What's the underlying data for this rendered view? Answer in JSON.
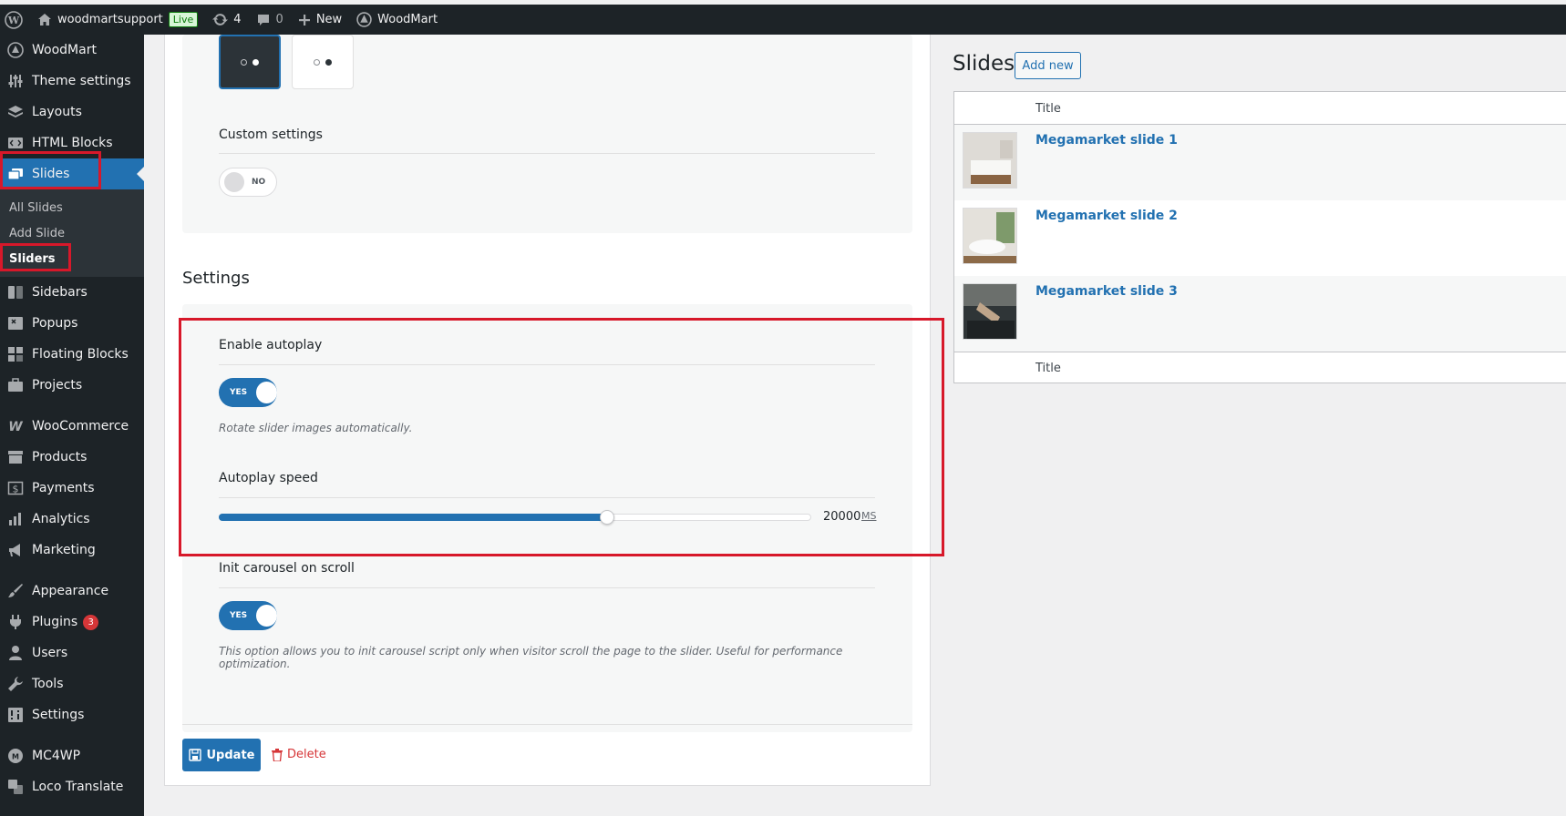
{
  "admin_bar": {
    "site_name": "woodmartsupport",
    "live_badge": "Live",
    "updates_count": "4",
    "comments_count": "0",
    "new_label": "New",
    "theme_label": "WoodMart"
  },
  "sidebar": {
    "items_top": [
      "WoodMart",
      "Theme settings",
      "Layouts",
      "HTML Blocks"
    ],
    "active_item": "Slides",
    "submenu": [
      "All Slides",
      "Add Slide",
      "Sliders"
    ],
    "items_mid": [
      "Sidebars",
      "Popups",
      "Floating Blocks",
      "Projects"
    ],
    "items_woo": [
      "WooCommerce",
      "Products",
      "Payments",
      "Analytics",
      "Marketing"
    ],
    "items_wp": [
      "Appearance",
      "Plugins",
      "Users",
      "Tools",
      "Settings"
    ],
    "plugins_badge": "3",
    "items_bottom": [
      "MC4WP",
      "Loco Translate"
    ]
  },
  "editor": {
    "custom_settings_label": "Custom settings",
    "custom_settings_toggle": "NO",
    "settings_heading": "Settings",
    "enable_autoplay_label": "Enable autoplay",
    "enable_autoplay_toggle": "YES",
    "enable_autoplay_hint": "Rotate slider images automatically.",
    "autoplay_speed_label": "Autoplay speed",
    "autoplay_speed_value": "20000",
    "autoplay_speed_unit": "MS",
    "autoplay_speed_fraction": 0.655,
    "init_carousel_label": "Init carousel on scroll",
    "init_carousel_toggle": "YES",
    "init_carousel_hint": "This option allows you to init carousel script only when visitor scroll the page to the slider. Useful for performance optimization.",
    "update_label": "Update",
    "delete_label": "Delete"
  },
  "slides_panel": {
    "heading": "Slides",
    "add_new_label": "Add new",
    "column_title": "Title",
    "footer_title": "Title",
    "rows": [
      "Megamarket slide 1",
      "Megamarket slide 2",
      "Megamarket slide 3"
    ]
  }
}
